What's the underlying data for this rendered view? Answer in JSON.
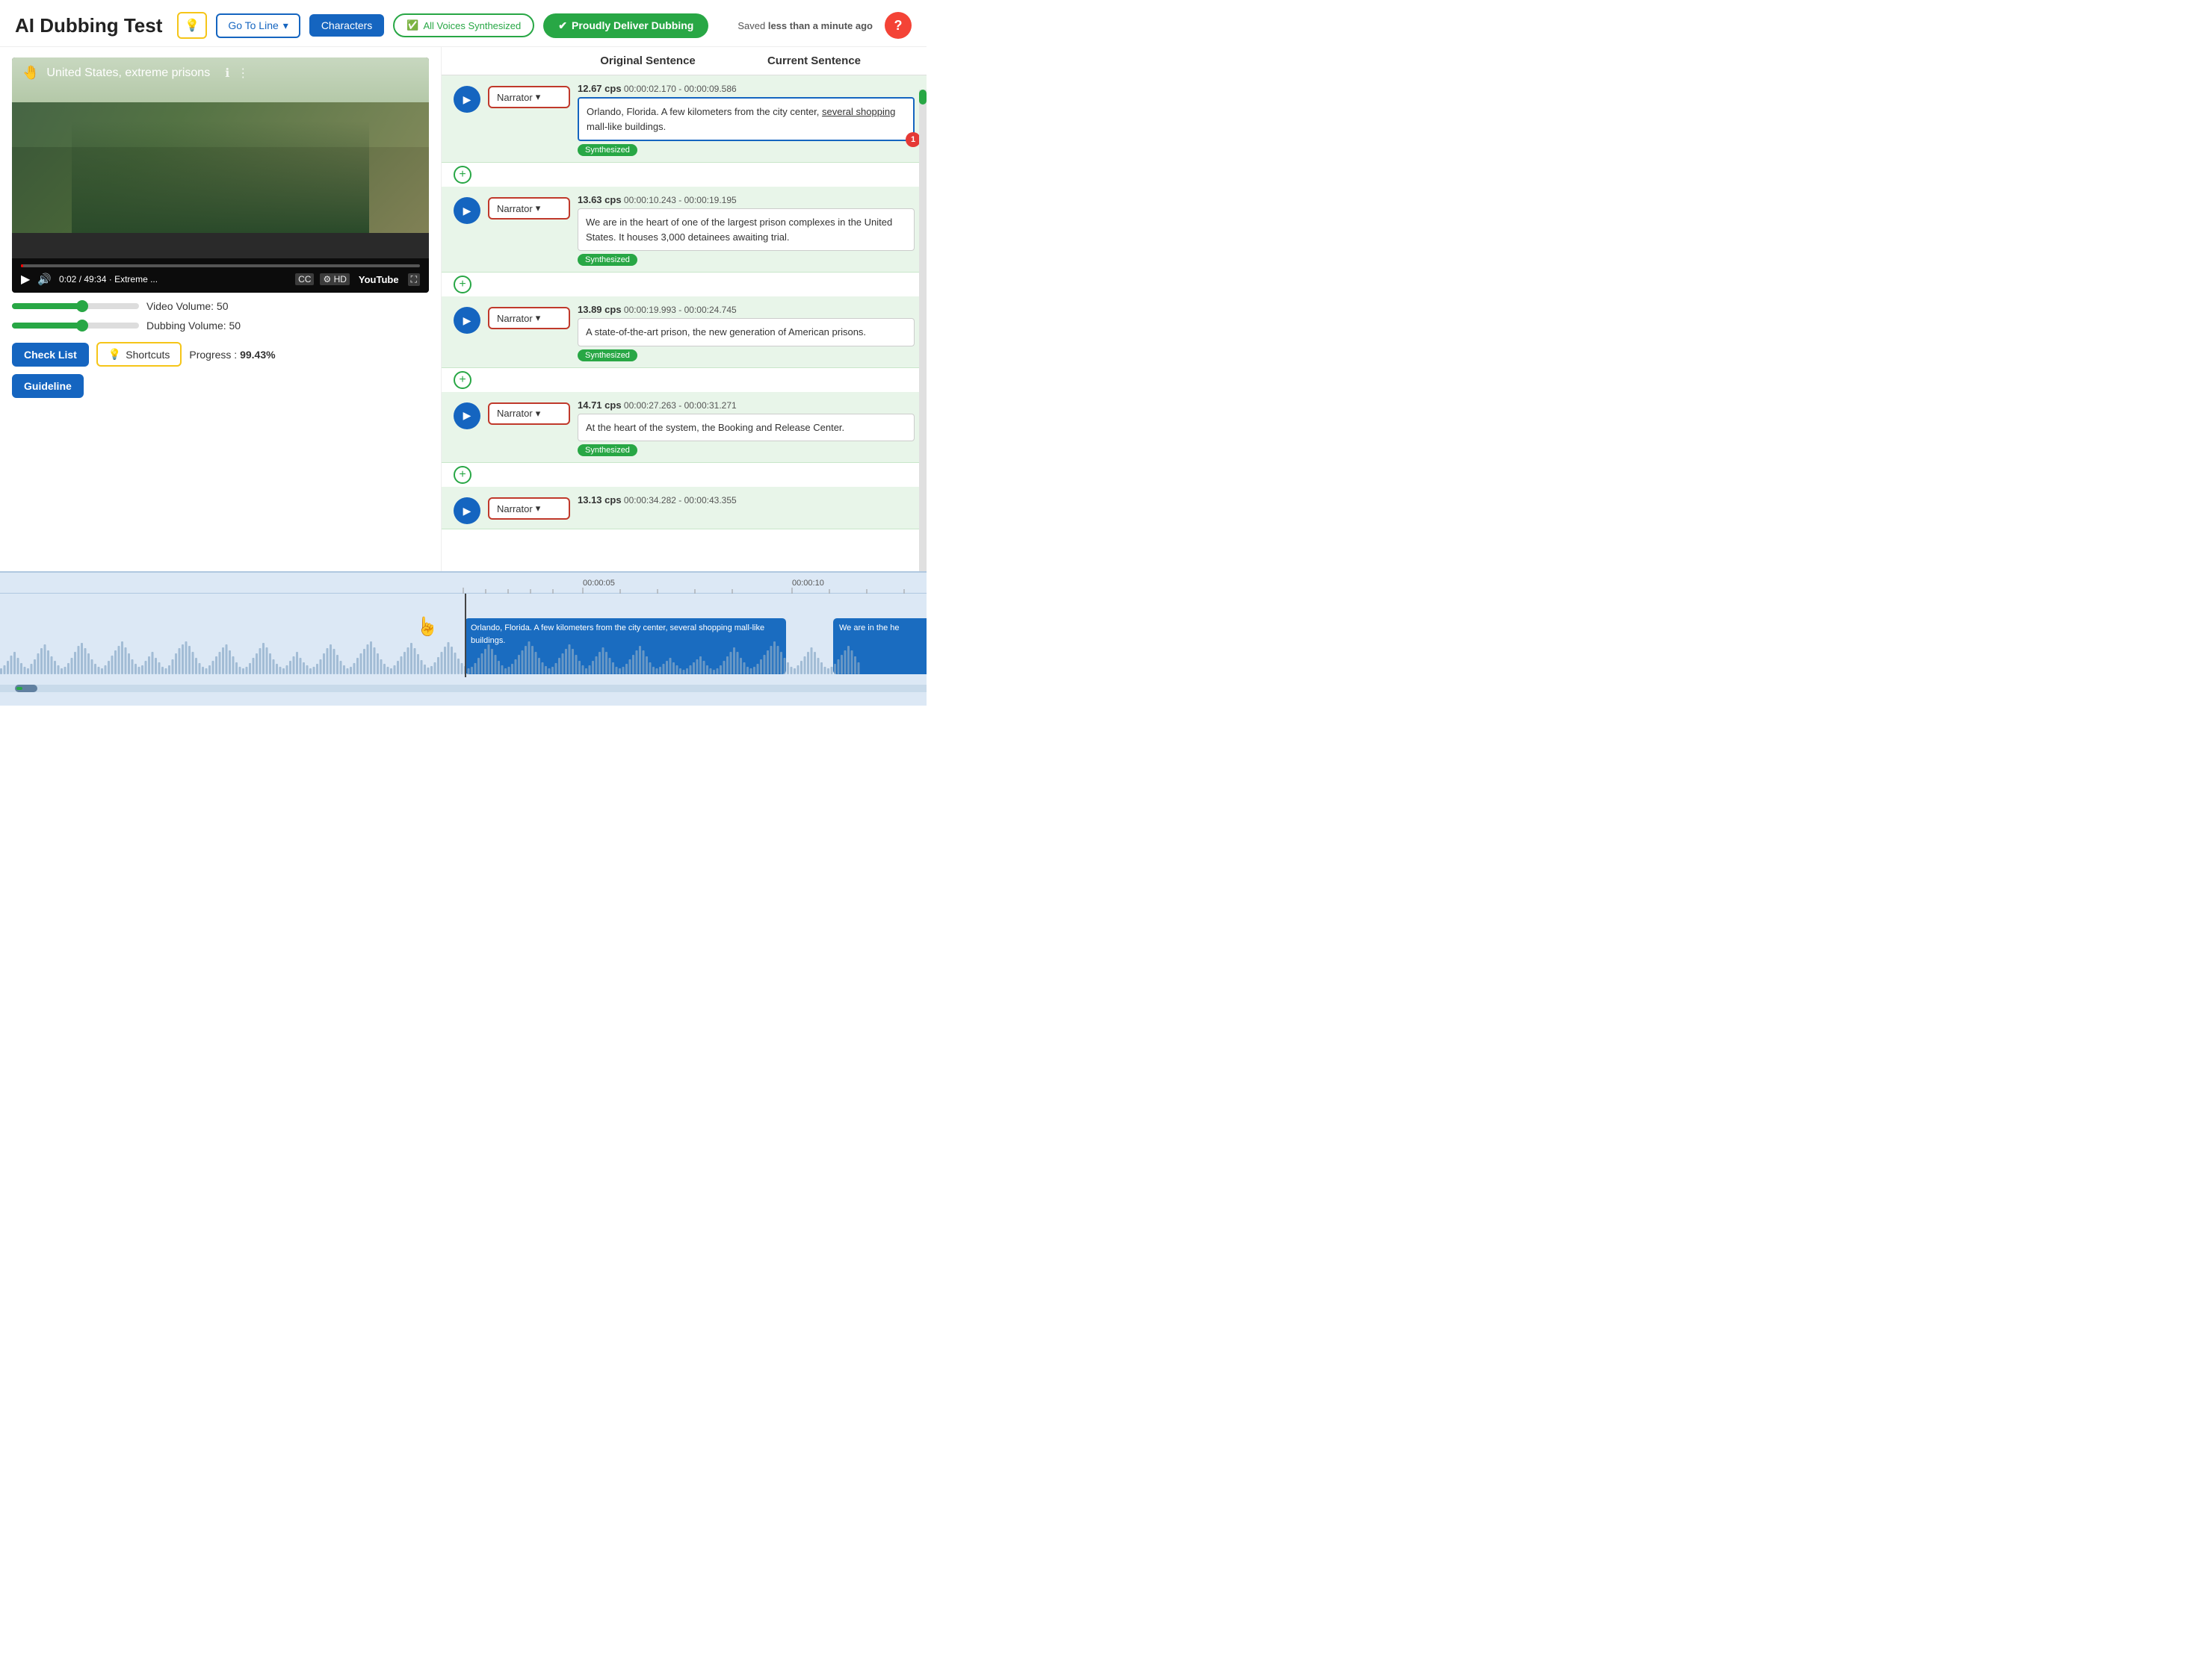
{
  "app": {
    "title": "AI Dubbing Test",
    "saved_text": "Saved ",
    "saved_bold": "less than a minute ago"
  },
  "toolbar": {
    "goto_line": "Go To Line",
    "characters": "Characters",
    "all_voices": "All Voices Synthesized",
    "deliver": "Proudly Deliver Dubbing",
    "help": "?"
  },
  "video": {
    "title": "United States, extreme prisons",
    "time": "0:02 / 49:34",
    "quality": "Extreme ...",
    "hd": "HD"
  },
  "sliders": {
    "video_label": "Video Volume: 50",
    "video_value": 50,
    "dubbing_label": "Dubbing Volume: 50",
    "dubbing_value": 50
  },
  "buttons": {
    "checklist": "Check List",
    "shortcuts": "Shortcuts",
    "guideline": "Guideline",
    "progress_prefix": "Progress : ",
    "progress_value": "99.43%"
  },
  "columns": {
    "original": "Original Sentence",
    "current": "Current Sentence"
  },
  "sentences": [
    {
      "id": 1,
      "cps": "12.67 cps",
      "time": "00:00:02.170 - 00:00:09.586",
      "character": "Narrator",
      "text": "Orlando, Florida. A few kilometers from the city center, several shopping mall-like buildings.",
      "underline": "several shopping",
      "synthesized": true,
      "error": "1",
      "active": true
    },
    {
      "id": 2,
      "cps": "13.63 cps",
      "time": "00:00:10.243 - 00:00:19.195",
      "character": "Narrator",
      "text": "We are in the heart of one of the largest prison complexes in the United States. It houses 3,000 detainees awaiting trial.",
      "synthesized": true,
      "active": false,
      "green_bar": true
    },
    {
      "id": 3,
      "cps": "13.89 cps",
      "time": "00:00:19.993 - 00:00:24.745",
      "character": "Narrator",
      "text": "A state-of-the-art prison, the new generation of American prisons.",
      "synthesized": true,
      "active": false
    },
    {
      "id": 4,
      "cps": "14.71 cps",
      "time": "00:00:27.263 - 00:00:31.271",
      "character": "Narrator",
      "text": "At the heart of the system, the Booking and Release Center.",
      "synthesized": true,
      "active": false
    },
    {
      "id": 5,
      "cps": "13.13 cps",
      "time": "00:00:34.282 - 00:00:43.355",
      "character": "Narrator",
      "text": "",
      "synthesized": false,
      "active": false
    }
  ],
  "timeline": {
    "marker_5s": "00:00:05",
    "marker_10s": "00:00:10",
    "block1_text": "Orlando, Florida. A few kilometers from the city center, several shopping mall-like buildings.",
    "block2_text": "We are in the he",
    "cursor_hand": "☝"
  }
}
